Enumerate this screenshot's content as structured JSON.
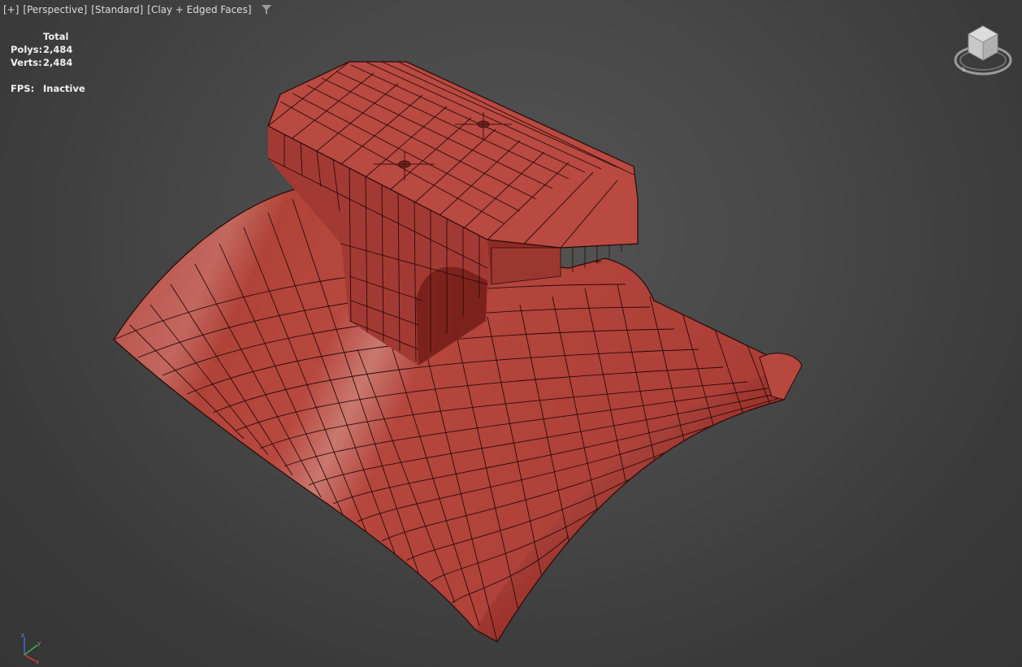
{
  "viewport": {
    "menu_plus": "[+]",
    "view_name": "[Perspective]",
    "shading_mode": "[Standard]",
    "display_mode": "[Clay + Edged Faces]",
    "filter_icon": "funnel-icon"
  },
  "stats": {
    "header": "Total",
    "polys_label": "Polys:",
    "polys_value": "2,484",
    "verts_label": "Verts:",
    "verts_value": "2,484",
    "fps_label": "FPS:",
    "fps_value": "Inactive"
  },
  "viewcube": {
    "icon": "viewcube-icon"
  },
  "axis_tripod": {
    "icon": "axis-tripod-icon",
    "x": "x",
    "y": "y",
    "z": "z"
  },
  "colors": {
    "clay": "#b7483f",
    "clay_dark": "#7a2420",
    "clay_light": "#d0837a",
    "wire": "#2a0a08",
    "background": "#464646"
  }
}
